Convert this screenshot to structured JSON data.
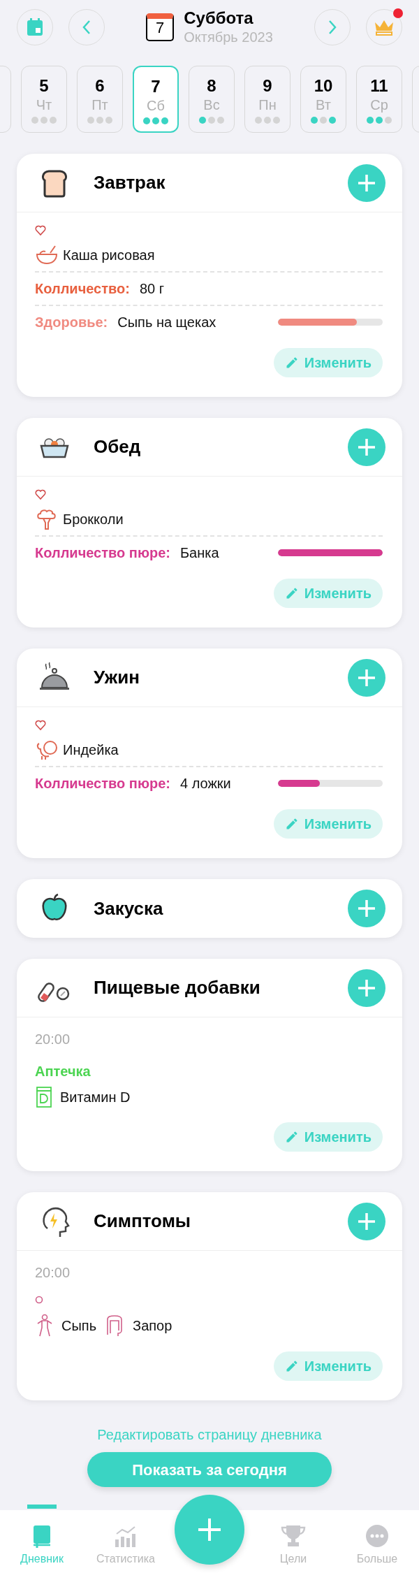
{
  "header": {
    "title": "Суббота",
    "subtitle": "Октябрь 2023",
    "calendar_day": "7",
    "notification": true
  },
  "days": [
    {
      "number": "5",
      "weekday": "Чт",
      "selected": false,
      "dots": [
        {
          "filled": false
        },
        {
          "filled": false
        },
        {
          "filled": false
        }
      ]
    },
    {
      "number": "6",
      "weekday": "Пт",
      "selected": false,
      "dots": [
        {
          "filled": false
        },
        {
          "filled": false
        },
        {
          "filled": false
        }
      ]
    },
    {
      "number": "7",
      "weekday": "Сб",
      "selected": true,
      "dots": [
        {
          "filled": true
        },
        {
          "filled": true
        },
        {
          "filled": true
        }
      ]
    },
    {
      "number": "8",
      "weekday": "Вс",
      "selected": false,
      "dots": [
        {
          "filled": true
        },
        {
          "filled": false
        },
        {
          "filled": false
        }
      ]
    },
    {
      "number": "9",
      "weekday": "Пн",
      "selected": false,
      "dots": [
        {
          "filled": false
        },
        {
          "filled": false
        },
        {
          "filled": false
        }
      ]
    },
    {
      "number": "10",
      "weekday": "Вт",
      "selected": false,
      "dots": [
        {
          "filled": true
        },
        {
          "filled": false
        },
        {
          "filled": true
        }
      ]
    },
    {
      "number": "11",
      "weekday": "Ср",
      "selected": false,
      "dots": [
        {
          "filled": true
        },
        {
          "filled": true
        },
        {
          "filled": false
        }
      ]
    }
  ],
  "cards": [
    {
      "title": "Завтрак",
      "edit_button": "Изменить",
      "rows": [
        {
          "kind": "heart"
        },
        {
          "kind": "food",
          "text": "Каша рисовая"
        },
        {
          "kind": "field",
          "label": "Колличество:",
          "value": "80 г",
          "color": "#e8603f"
        },
        {
          "kind": "field",
          "label": "Здоровье:",
          "value": "Сыпь на щеках",
          "color": "#f08a80",
          "level": 0.75
        }
      ]
    },
    {
      "title": "Обед",
      "edit_button": "Изменить",
      "rows": [
        {
          "kind": "heart"
        },
        {
          "kind": "food",
          "text": "Брокколи"
        },
        {
          "kind": "field",
          "label": "Колличество пюре:",
          "value": "Банка",
          "color": "#d63a8f",
          "level": 1
        }
      ]
    },
    {
      "title": "Ужин",
      "edit_button": "Изменить",
      "rows": [
        {
          "kind": "heart"
        },
        {
          "kind": "food",
          "text": "Индейка"
        },
        {
          "kind": "field",
          "label": "Колличество пюре:",
          "value": "4 ложки",
          "color": "#d63a8f",
          "level": 0.4
        }
      ]
    },
    {
      "title": "Закуска"
    },
    {
      "title": "Пищевые добавки",
      "edit_button": "Изменить",
      "rows": [
        {
          "kind": "time",
          "text": "20:00"
        },
        {
          "kind": "group",
          "text": "Аптечка"
        },
        {
          "kind": "supplement",
          "text": "Витамин D"
        }
      ]
    },
    {
      "title": "Симптомы",
      "edit_button": "Изменить",
      "rows": [
        {
          "kind": "time",
          "text": "20:00"
        },
        {
          "kind": "circle"
        },
        {
          "kind": "symptoms",
          "items": [
            "Сыпь",
            "Запор"
          ]
        }
      ]
    }
  ],
  "edit_page_link": "Редактировать страницу дневника",
  "today_button": "Показать за сегодня",
  "nav": [
    {
      "label": "Дневник",
      "selected": true
    },
    {
      "label": "Статистика",
      "selected": false
    },
    {
      "label": "Цели",
      "selected": false
    },
    {
      "label": "Больше",
      "selected": false
    }
  ]
}
